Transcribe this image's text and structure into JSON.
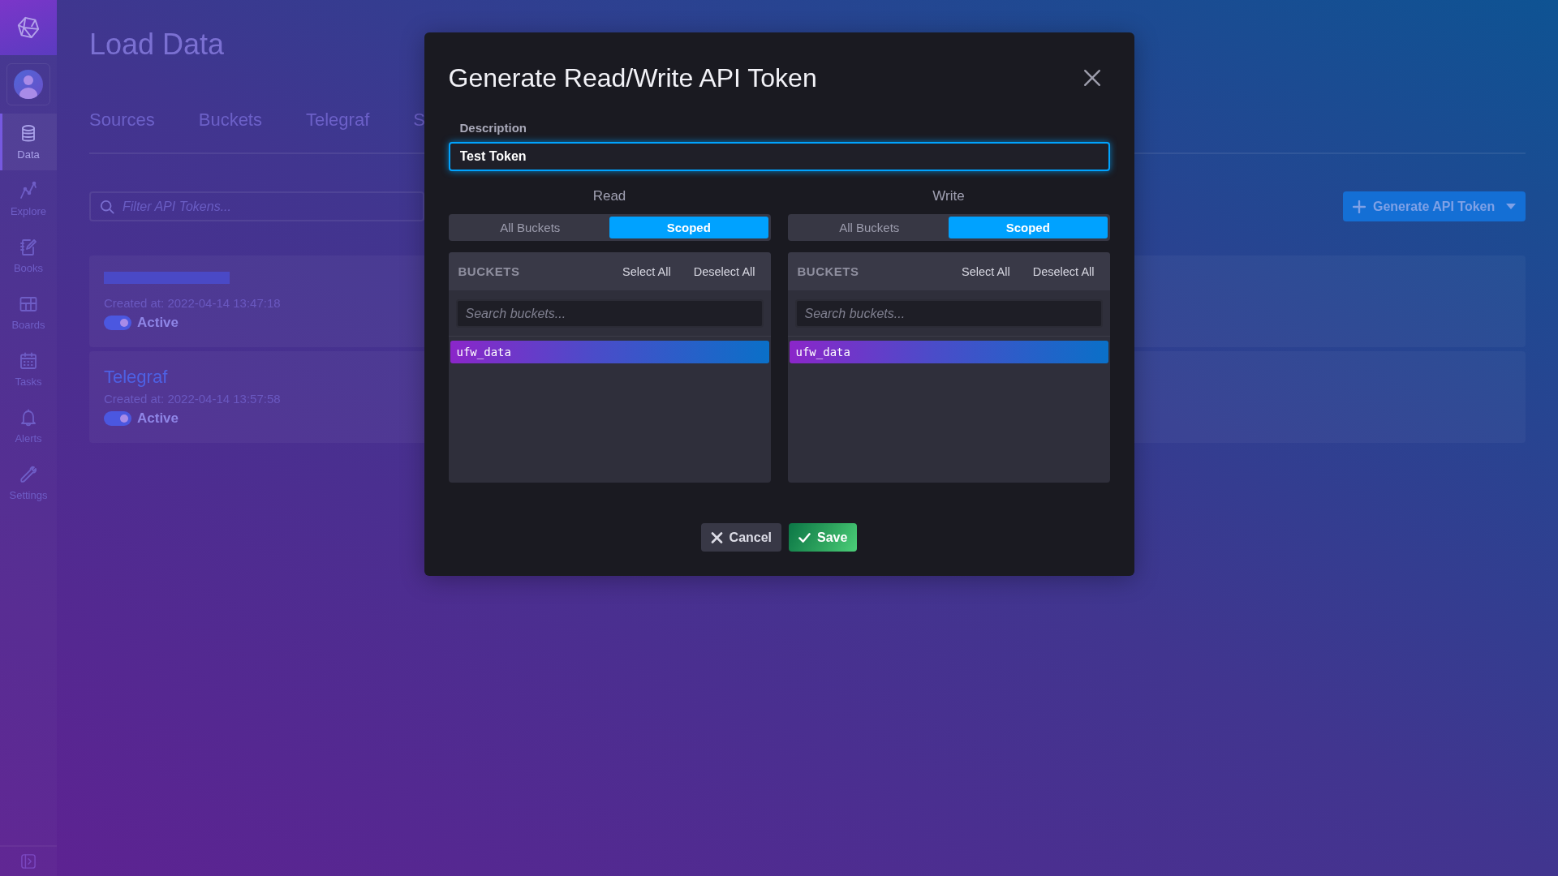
{
  "sidebar": {
    "items": [
      {
        "label": "Data",
        "selected": true
      },
      {
        "label": "Explore",
        "selected": false
      },
      {
        "label": "Books",
        "selected": false
      },
      {
        "label": "Boards",
        "selected": false
      },
      {
        "label": "Tasks",
        "selected": false
      },
      {
        "label": "Alerts",
        "selected": false
      },
      {
        "label": "Settings",
        "selected": false
      }
    ]
  },
  "page": {
    "title": "Load Data",
    "tabs": [
      {
        "label": "Sources",
        "selected": false
      },
      {
        "label": "Buckets",
        "selected": false
      },
      {
        "label": "Telegraf",
        "selected": false
      },
      {
        "label": "S",
        "selected": false
      }
    ],
    "filter": {
      "placeholder": "Filter API Tokens..."
    },
    "generate_button": {
      "label": "Generate API Token"
    },
    "tokens": [
      {
        "title_redacted": true,
        "created": "Created at: 2022-04-14 13:47:18",
        "active": true,
        "status": "Active"
      },
      {
        "title_redacted": false,
        "title": "Telegraf",
        "created": "Created at: 2022-04-14 13:57:58",
        "active": true,
        "status": "Active"
      }
    ]
  },
  "dialog": {
    "title": "Generate Read/Write API Token",
    "description": {
      "label": "Description",
      "value": "Test Token"
    },
    "permissions": [
      {
        "heading": "Read",
        "scope_options": [
          {
            "label": "All Buckets",
            "selected": false
          },
          {
            "label": "Scoped",
            "selected": true
          }
        ],
        "panel_title": "BUCKETS",
        "actions": [
          "Select All",
          "Deselect All"
        ],
        "search": {
          "placeholder": "Search buckets..."
        },
        "buckets": [
          {
            "name": "ufw_data",
            "selected": true
          }
        ]
      },
      {
        "heading": "Write",
        "scope_options": [
          {
            "label": "All Buckets",
            "selected": false
          },
          {
            "label": "Scoped",
            "selected": true
          }
        ],
        "panel_title": "BUCKETS",
        "actions": [
          "Select All",
          "Deselect All"
        ],
        "search": {
          "placeholder": "Search buckets..."
        },
        "buckets": [
          {
            "name": "ufw_data",
            "selected": true
          }
        ]
      }
    ],
    "buttons": [
      {
        "label": "Cancel",
        "kind": "cancel"
      },
      {
        "label": "Save",
        "kind": "save"
      }
    ]
  }
}
